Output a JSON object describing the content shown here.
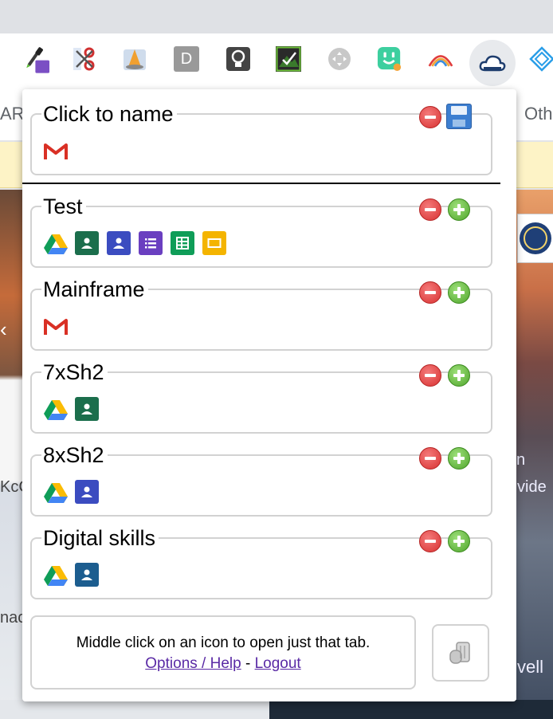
{
  "bookmarks": {
    "left_fragment": "AR",
    "right_fragment": "Oth"
  },
  "background": {
    "frag_left_1": "KcC",
    "frag_left_2": "nac",
    "frag_right_1": "n",
    "frag_right_2": "vide",
    "frag_right_3": "vell"
  },
  "extensions": [
    "eyedropper-icon",
    "scissors-icon",
    "cone-icon",
    "letter-d-icon",
    "lightbulb-icon",
    "mountain-check-icon",
    "move-icon",
    "face-icon",
    "rainbow-icon",
    "cloud-icon",
    "diamond-icon"
  ],
  "extension_letter": "D",
  "popup": {
    "new_session": {
      "title": "Click to name",
      "icons": [
        "gmail-icon"
      ]
    },
    "groups": [
      {
        "title": "Test",
        "icons": [
          "drive-icon",
          "classroom-green-icon",
          "classroom-blue-icon",
          "forms-icon",
          "sheets-icon",
          "slides-icon"
        ]
      },
      {
        "title": "Mainframe",
        "icons": [
          "gmail-icon"
        ]
      },
      {
        "title": "7xSh2",
        "icons": [
          "drive-icon",
          "classroom-green-icon"
        ]
      },
      {
        "title": "8xSh2",
        "icons": [
          "drive-icon",
          "classroom-blue-icon"
        ]
      },
      {
        "title": "Digital skills",
        "icons": [
          "drive-icon",
          "classroom-navy-icon"
        ]
      }
    ],
    "footer": {
      "message": "Middle click on an icon to open just that tab.",
      "options_link": "Options / Help",
      "separator": " - ",
      "logout_link": "Logout"
    }
  },
  "colors": {
    "remove": "#d83232",
    "add": "#4fa52c",
    "link": "#5a2aa5",
    "notice": "#fdf3c6"
  }
}
